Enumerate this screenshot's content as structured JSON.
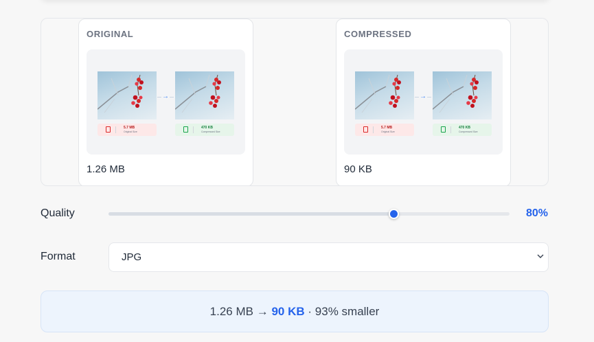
{
  "preview": {
    "original": {
      "label": "ORIGINAL",
      "size": "1.26 MB"
    },
    "compressed": {
      "label": "COMPRESSED",
      "size": "90 KB"
    },
    "thumbnail": {
      "before_size": "5.7 MB",
      "before_caption": "Original Size",
      "after_size": "470 KB",
      "after_caption": "Compressed Size"
    }
  },
  "quality": {
    "label": "Quality",
    "value_text": "80%",
    "value_fraction": 0.71
  },
  "format": {
    "label": "Format",
    "selected": "JPG"
  },
  "summary": {
    "from": "1.26 MB",
    "arrow": "→",
    "to": "90 KB",
    "separator": "·",
    "reduction": "93% smaller"
  },
  "colors": {
    "accent": "#2563eb",
    "summary_bg": "#edf4fd"
  }
}
